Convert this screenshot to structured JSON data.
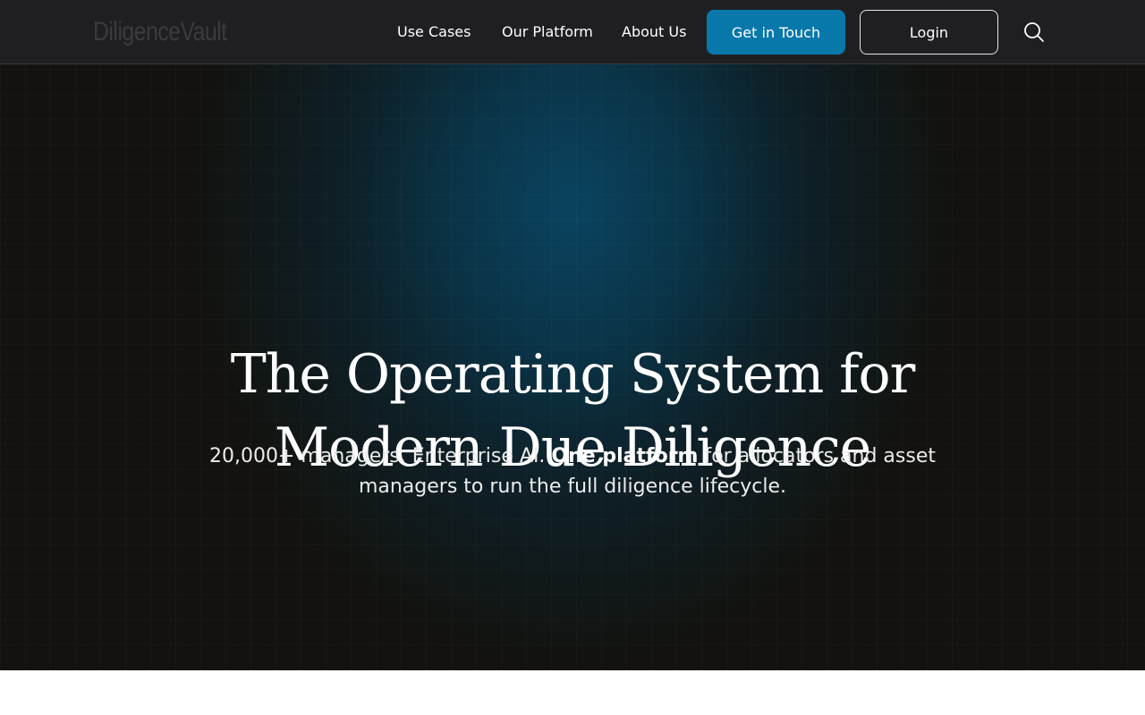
{
  "header": {
    "logo_text": "DiligenceVault",
    "nav": {
      "use_cases": "Use Cases",
      "our_platform": "Our Platform",
      "about_us": "About Us"
    },
    "get_in_touch": "Get in Touch",
    "login": "Login",
    "search_icon": "search-icon"
  },
  "hero": {
    "title_line1": "The Operating System for",
    "title_line2": "Modern Due Diligence",
    "subtitle_part1": "20,000+ managers. Enterprise AI. ",
    "subtitle_bold": "One platform",
    "subtitle_part2": " for allocators and asset managers to run the full diligence lifecycle."
  },
  "colors": {
    "accent": "#0878ab",
    "header_bg": "#1f1f22",
    "hero_bg": "#13120e"
  }
}
